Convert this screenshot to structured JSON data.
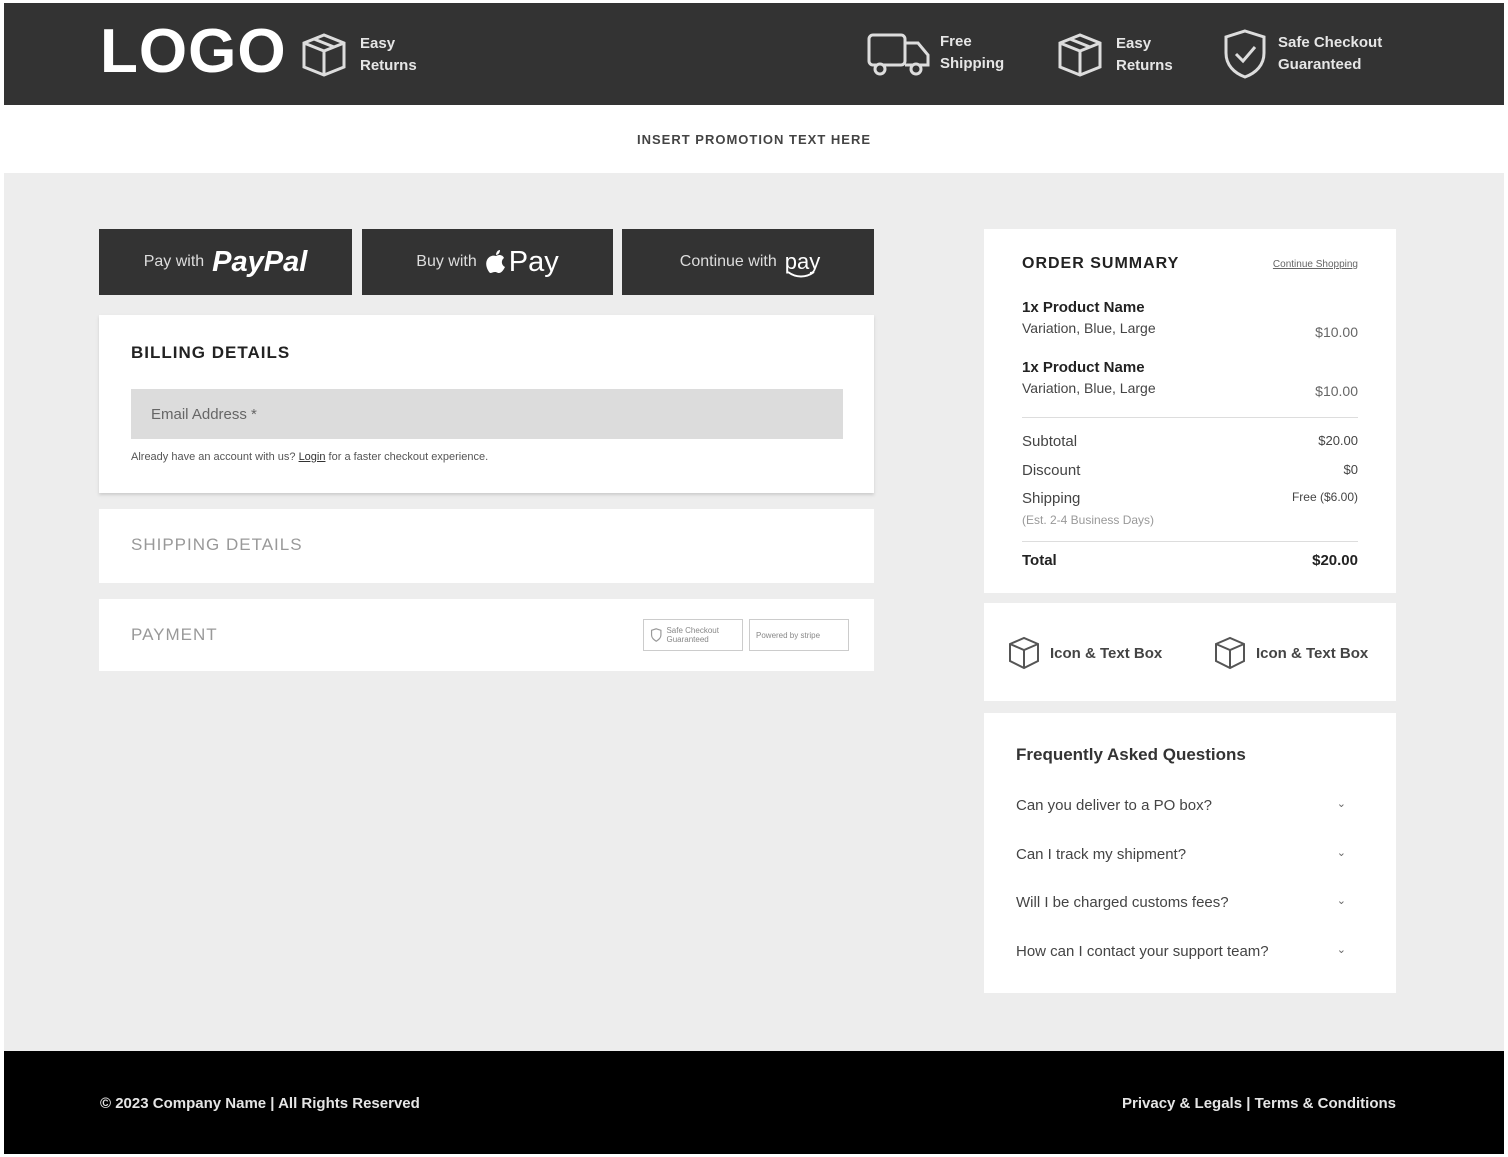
{
  "header": {
    "logo": "LOGO",
    "logo_badge": {
      "icon": "box-icon",
      "text": "Easy\nReturns"
    },
    "badges": [
      {
        "icon": "truck-icon",
        "text": "Free\nShipping"
      },
      {
        "icon": "box-icon",
        "text": "Easy\nReturns"
      },
      {
        "icon": "shield-check-icon",
        "text": "Safe Checkout\nGuaranteed"
      }
    ]
  },
  "promo": {
    "text": "INSERT PROMOTION TEXT HERE"
  },
  "express_pay": {
    "paypal": {
      "prefix": "Pay with",
      "brand": "PayPal"
    },
    "applepay": {
      "prefix": "Buy with",
      "brand": "Pay"
    },
    "amazonpay": {
      "prefix": "Continue with",
      "brand": "pay"
    }
  },
  "billing": {
    "title": "BILLING DETAILS",
    "email_placeholder": "Email Address *",
    "note_before": "Already have an account with us?",
    "note_link": "Login",
    "note_after": "for a faster checkout experience."
  },
  "shipping": {
    "title": "SHIPPING DETAILS"
  },
  "payment": {
    "title": "PAYMENT",
    "badge1": "Safe Checkout Guaranteed",
    "badge2": "Powered by stripe"
  },
  "summary": {
    "title": "ORDER SUMMARY",
    "link": "Continue Shopping",
    "items": [
      {
        "name": "1x Product Name",
        "variant": "Variation, Blue, Large",
        "price": "$10.00"
      },
      {
        "name": "1x Product Name",
        "variant": "Variation, Blue, Large",
        "price": "$10.00"
      }
    ],
    "subtotal_label": "Subtotal",
    "subtotal": "$20.00",
    "discount_label": "Discount",
    "discount": "$0",
    "shipping_label": "Shipping",
    "shipping": "Free ($6.00)",
    "shipping_note": "(Est. 2-4 Business Days)",
    "total_label": "Total",
    "total": "$20.00"
  },
  "features": [
    {
      "icon": "box-icon",
      "label": "Icon & Text Box"
    },
    {
      "icon": "box-icon",
      "label": "Icon & Text Box"
    }
  ],
  "faq": {
    "title": "Frequently Asked Questions",
    "items": [
      "Can you deliver to a PO box?",
      "Can I track my shipment?",
      "Will I be charged customs fees?",
      "How can I contact your support team?"
    ]
  },
  "footer": {
    "copyright": "© 2023 Company Name | All Rights Reserved",
    "links": "Privacy & Legals | Terms & Conditions"
  },
  "colors": {
    "header_bg": "#333333",
    "page_bg": "#ededed",
    "footer_bg": "#000000"
  }
}
